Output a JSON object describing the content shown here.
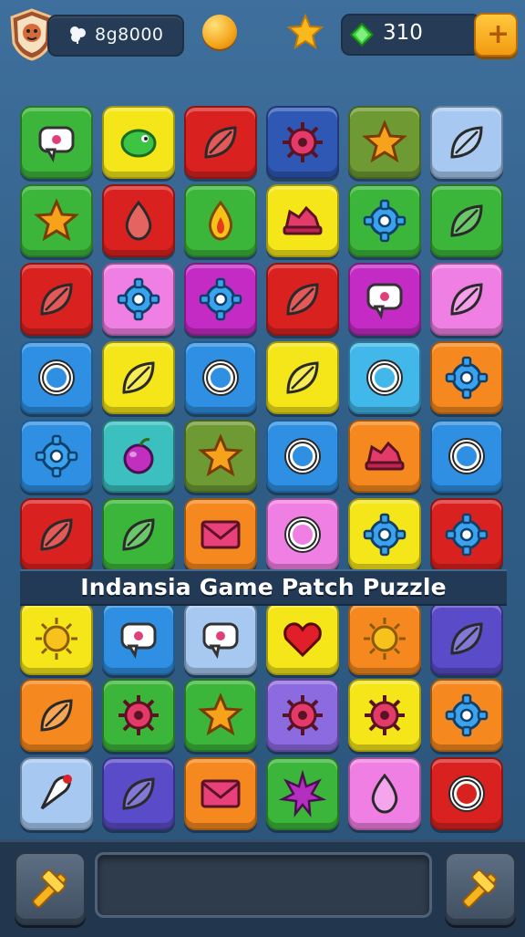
{
  "header": {
    "coins_text": "8g8000",
    "gems_text": "310",
    "add_label": "+"
  },
  "banner": {
    "title": "Indansia Game Patch Puzzle"
  },
  "colors": {
    "green": "#3bb53a",
    "yellow": "#f5e61a",
    "red": "#d9221f",
    "navy": "#2e58b4",
    "olive": "#6e9a34",
    "lightblue": "#a7c8f0",
    "pink": "#f07fe3",
    "magenta": "#c42bc5",
    "skyblue": "#42b7e9",
    "blue": "#2f8fe2",
    "teal": "#3bbfbf",
    "orange": "#f5881e",
    "purple": "#8c6ae0",
    "indigo": "#5a4bc9"
  },
  "board": {
    "rows": [
      [
        {
          "color": "green",
          "icon": "speech-bubble-icon"
        },
        {
          "color": "yellow",
          "icon": "chameleon-icon"
        },
        {
          "color": "red",
          "icon": "leaf-icon"
        },
        {
          "color": "navy",
          "icon": "spiky-gear-icon"
        },
        {
          "color": "olive",
          "icon": "star-icon"
        },
        {
          "color": "lightblue",
          "icon": "leaf-icon"
        }
      ],
      [
        {
          "color": "green",
          "icon": "star-icon"
        },
        {
          "color": "red",
          "icon": "drop-icon"
        },
        {
          "color": "green",
          "icon": "flame-drop-icon"
        },
        {
          "color": "yellow",
          "icon": "hat-icon"
        },
        {
          "color": "green",
          "icon": "gear-icon"
        },
        {
          "color": "green",
          "icon": "leaf-icon"
        }
      ],
      [
        {
          "color": "red",
          "icon": "leaf-icon"
        },
        {
          "color": "pink",
          "icon": "gear-icon"
        },
        {
          "color": "magenta",
          "icon": "gear-icon"
        },
        {
          "color": "red",
          "icon": "leaf-icon"
        },
        {
          "color": "magenta",
          "icon": "speech-bubble-icon"
        },
        {
          "color": "pink",
          "icon": "leaf-icon"
        }
      ],
      [
        {
          "color": "blue",
          "icon": "ring-icon"
        },
        {
          "color": "yellow",
          "icon": "leaf-icon"
        },
        {
          "color": "blue",
          "icon": "ring-icon"
        },
        {
          "color": "yellow",
          "icon": "leaf-icon"
        },
        {
          "color": "skyblue",
          "icon": "ring-icon"
        },
        {
          "color": "orange",
          "icon": "gear-icon"
        }
      ],
      [
        {
          "color": "blue",
          "icon": "gear-icon"
        },
        {
          "color": "teal",
          "icon": "berry-icon"
        },
        {
          "color": "olive",
          "icon": "star-icon"
        },
        {
          "color": "blue",
          "icon": "ring-icon"
        },
        {
          "color": "orange",
          "icon": "hat-icon"
        },
        {
          "color": "blue",
          "icon": "ring-icon"
        }
      ],
      [
        {
          "color": "red",
          "icon": "leaf-icon"
        },
        {
          "color": "green",
          "icon": "leaf-icon"
        },
        {
          "color": "orange",
          "icon": "envelope-icon"
        },
        {
          "color": "pink",
          "icon": "ring-icon"
        },
        {
          "color": "yellow",
          "icon": "gear-icon"
        },
        {
          "color": "red",
          "icon": "gear-icon"
        }
      ],
      [
        {
          "color": "yellow",
          "icon": "sun-icon"
        },
        {
          "color": "blue",
          "icon": "speech-bubble-icon"
        },
        {
          "color": "lightblue",
          "icon": "speech-bubble-icon"
        },
        {
          "color": "yellow",
          "icon": "heart-icon"
        },
        {
          "color": "orange",
          "icon": "sun-icon"
        },
        {
          "color": "indigo",
          "icon": "leaf-icon"
        }
      ],
      [
        {
          "color": "orange",
          "icon": "leaf-icon"
        },
        {
          "color": "green",
          "icon": "spiky-gear-icon"
        },
        {
          "color": "green",
          "icon": "star-icon"
        },
        {
          "color": "purple",
          "icon": "spiky-gear-icon"
        },
        {
          "color": "yellow",
          "icon": "spiky-gear-icon"
        },
        {
          "color": "orange",
          "icon": "gear-icon"
        }
      ],
      [
        {
          "color": "lightblue",
          "icon": "rocket-icon"
        },
        {
          "color": "indigo",
          "icon": "leaf-icon"
        },
        {
          "color": "orange",
          "icon": "envelope-icon"
        },
        {
          "color": "green",
          "icon": "spiky-star-icon"
        },
        {
          "color": "pink",
          "icon": "drop-icon"
        },
        {
          "color": "red",
          "icon": "ring-icon"
        }
      ]
    ]
  }
}
